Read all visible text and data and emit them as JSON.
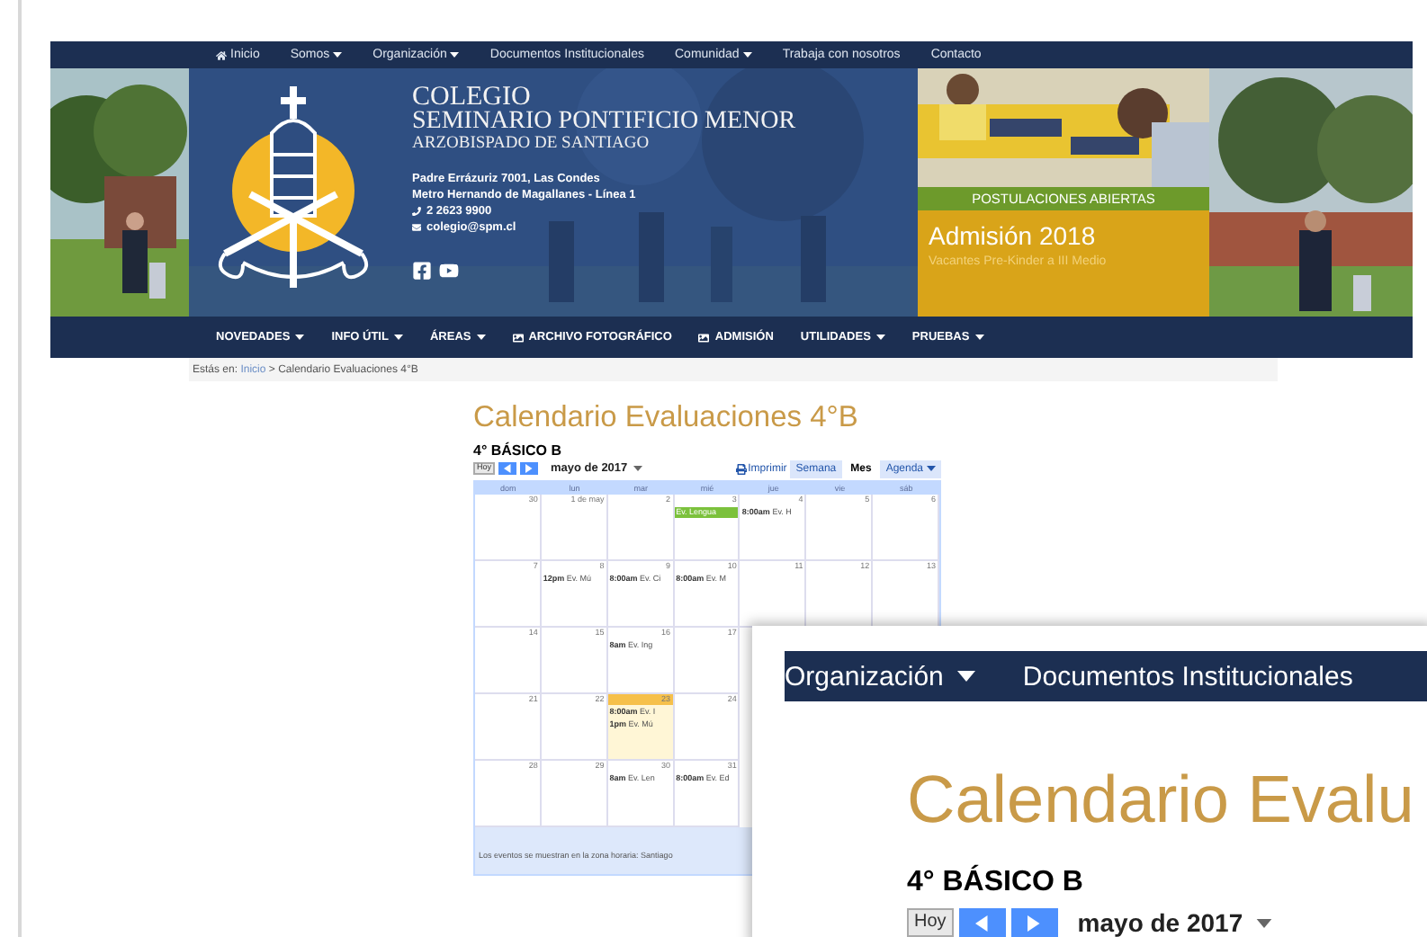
{
  "top_nav": [
    {
      "label": "Inicio",
      "kind": "home"
    },
    {
      "label": "Somos",
      "kind": "menu"
    },
    {
      "label": "Organización",
      "kind": "menu"
    },
    {
      "label": "Documentos Institucionales",
      "kind": "link"
    },
    {
      "label": "Comunidad",
      "kind": "menu"
    },
    {
      "label": "Trabaja con nosotros",
      "kind": "link"
    },
    {
      "label": "Contacto",
      "kind": "link"
    }
  ],
  "header": {
    "name_lines": [
      "COLEGIO",
      "SEMINARIO PONTIFICIO MENOR"
    ],
    "subtitle": "ARZOBISPADO DE SANTIAGO",
    "address": "Padre Errázuriz 7001, Las Condes",
    "metro": "Metro Hernando de Magallanes - Línea 1",
    "phone": "2 2623 9900",
    "email": "colegio@spm.cl"
  },
  "banner": {
    "tag": "POSTULACIONES ABIERTAS",
    "title": "Admisión 2018",
    "subtitle": "Vacantes Pre-Kinder a III Medio"
  },
  "main_nav": [
    {
      "label": "NOVEDADES",
      "kind": "menu"
    },
    {
      "label": "INFO ÚTIL",
      "kind": "menu"
    },
    {
      "label": "ÁREAS",
      "kind": "menu"
    },
    {
      "label": "ARCHIVO FOTOGRÁFICO",
      "kind": "page"
    },
    {
      "label": "ADMISIÓN",
      "kind": "page"
    },
    {
      "label": "UTILIDADES",
      "kind": "menu"
    },
    {
      "label": "PRUEBAS",
      "kind": "menu"
    }
  ],
  "breadcrumb": {
    "prefix": "Estás en:",
    "link": "Inicio",
    "separator": ">",
    "current": "Calendario Evaluaciones 4°B"
  },
  "page_title": "Calendario Evaluaciones 4°B",
  "calendar": {
    "title": "4° BÁSICO B",
    "today_button": "Hoy",
    "month": "mayo de 2017",
    "print": "Imprimir",
    "views": [
      {
        "label": "Semana",
        "selected": false
      },
      {
        "label": "Mes",
        "selected": true
      },
      {
        "label": "Agenda",
        "selected": false
      }
    ],
    "weekdays": [
      "dom",
      "lun",
      "mar",
      "mié",
      "jue",
      "vie",
      "sáb"
    ],
    "weeks": [
      {
        "days": [
          {
            "label": "30",
            "today": false
          },
          {
            "label": "1 de may",
            "today": false
          },
          {
            "label": "2",
            "today": false
          },
          {
            "label": "3",
            "today": false,
            "events": [
              {
                "kind": "allday",
                "title": "Ev. Lengua"
              }
            ]
          },
          {
            "label": "4",
            "today": false,
            "events": [
              {
                "kind": "timed",
                "time": "8:00am",
                "title": "Ev. H"
              }
            ]
          },
          {
            "label": "5",
            "today": false
          },
          {
            "label": "6",
            "today": false
          }
        ]
      },
      {
        "days": [
          {
            "label": "7",
            "today": false
          },
          {
            "label": "8",
            "today": false,
            "events": [
              {
                "kind": "timed",
                "time": "12pm",
                "title": "Ev. Mú"
              }
            ]
          },
          {
            "label": "9",
            "today": false,
            "events": [
              {
                "kind": "timed",
                "time": "8:00am",
                "title": "Ev. Ci"
              }
            ]
          },
          {
            "label": "10",
            "today": false,
            "events": [
              {
                "kind": "timed",
                "time": "8:00am",
                "title": "Ev. M"
              }
            ]
          },
          {
            "label": "11",
            "today": false
          },
          {
            "label": "12",
            "today": false
          },
          {
            "label": "13",
            "today": false
          }
        ]
      },
      {
        "days": [
          {
            "label": "14",
            "today": false
          },
          {
            "label": "15",
            "today": false
          },
          {
            "label": "16",
            "today": false,
            "events": [
              {
                "kind": "timed",
                "time": "8am",
                "title": "Ev. Ing"
              }
            ]
          },
          {
            "label": "17",
            "today": false
          }
        ]
      },
      {
        "days": [
          {
            "label": "21",
            "today": false
          },
          {
            "label": "22",
            "today": false
          },
          {
            "label": "23",
            "today": true,
            "events": [
              {
                "kind": "timed",
                "time": "8:00am",
                "title": "Ev. I"
              },
              {
                "kind": "timed",
                "time": "1pm",
                "title": "Ev. Mú"
              }
            ]
          },
          {
            "label": "24",
            "today": false
          }
        ]
      },
      {
        "days": [
          {
            "label": "28",
            "today": false
          },
          {
            "label": "29",
            "today": false
          },
          {
            "label": "30",
            "today": false,
            "events": [
              {
                "kind": "timed",
                "time": "8am",
                "title": "Ev. Len"
              }
            ]
          },
          {
            "label": "31",
            "today": false,
            "events": [
              {
                "kind": "timed",
                "time": "8:00am",
                "title": "Ev. Ed"
              }
            ]
          }
        ]
      }
    ],
    "footer": "Los eventos se muestran en la zona horaria: Santiago"
  },
  "inset": {
    "nav": [
      {
        "label": "Organización",
        "kind": "menu"
      },
      {
        "label": "Documentos Institucionales",
        "kind": "link"
      }
    ],
    "title": "Calendario Evalu",
    "calendar_title": "4° BÁSICO B",
    "today_button": "Hoy",
    "month": "mayo de 2017"
  }
}
